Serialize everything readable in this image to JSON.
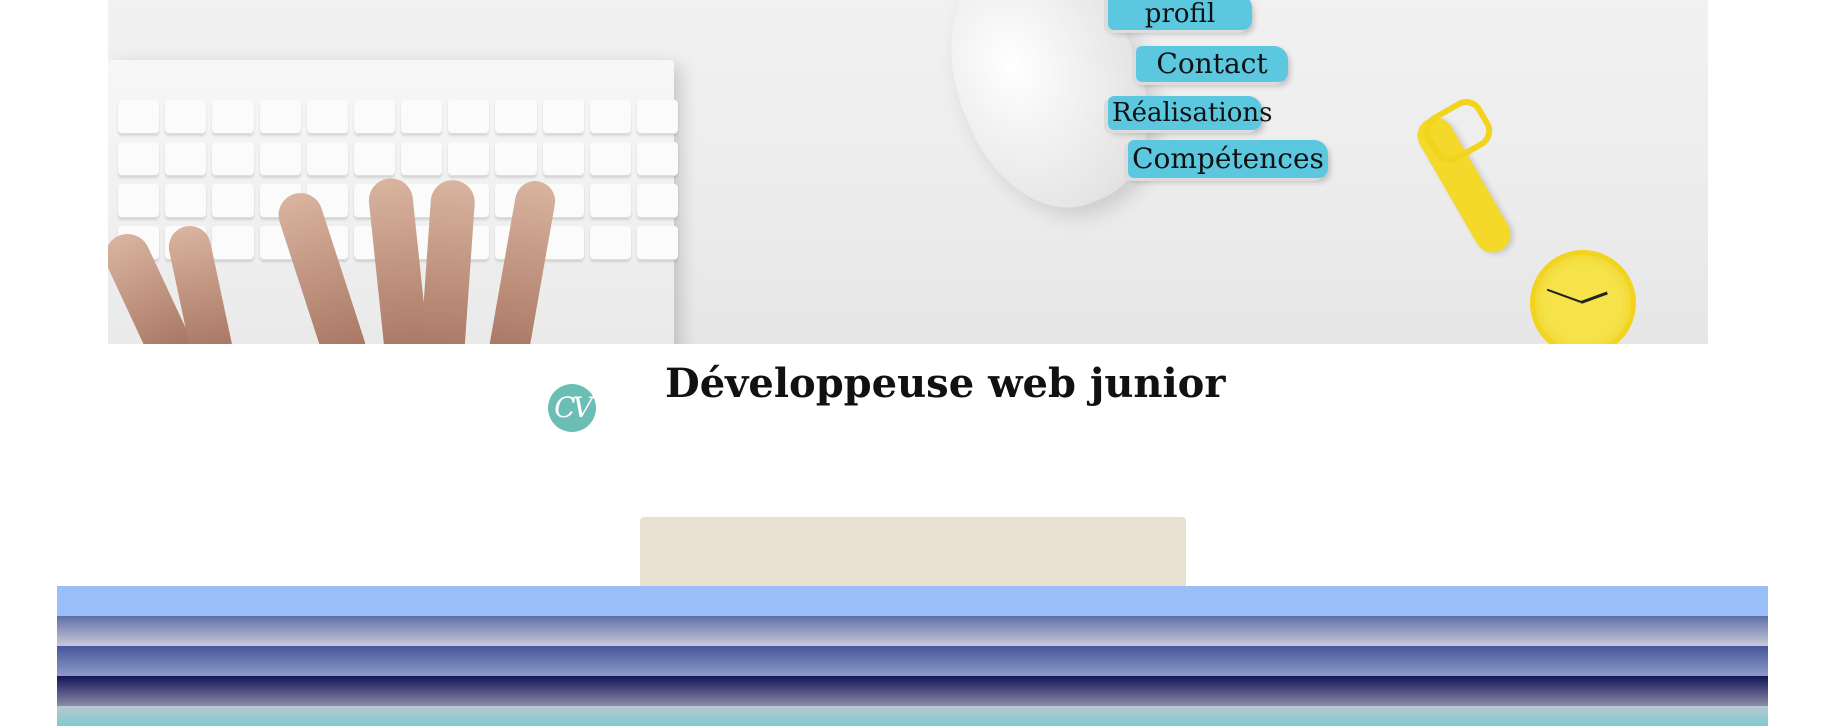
{
  "nav": {
    "profil": "profil",
    "contact": "Contact",
    "realisations": "Réalisations",
    "competences": "Compétences"
  },
  "logo": {
    "text": "CV"
  },
  "header": {
    "title": "Développeuse web junior"
  },
  "colors": {
    "nav_accent": "#5bc8df",
    "logo_bg": "#6bbeb4",
    "beige_panel": "#e8e1d2",
    "stripe_light_blue": "#9abef7",
    "stripe_navy": "#14145a",
    "stripe_teal": "#7fc9cf"
  },
  "hero_image": {
    "subject": "keyboard, mouse and yellow watch on desk"
  }
}
